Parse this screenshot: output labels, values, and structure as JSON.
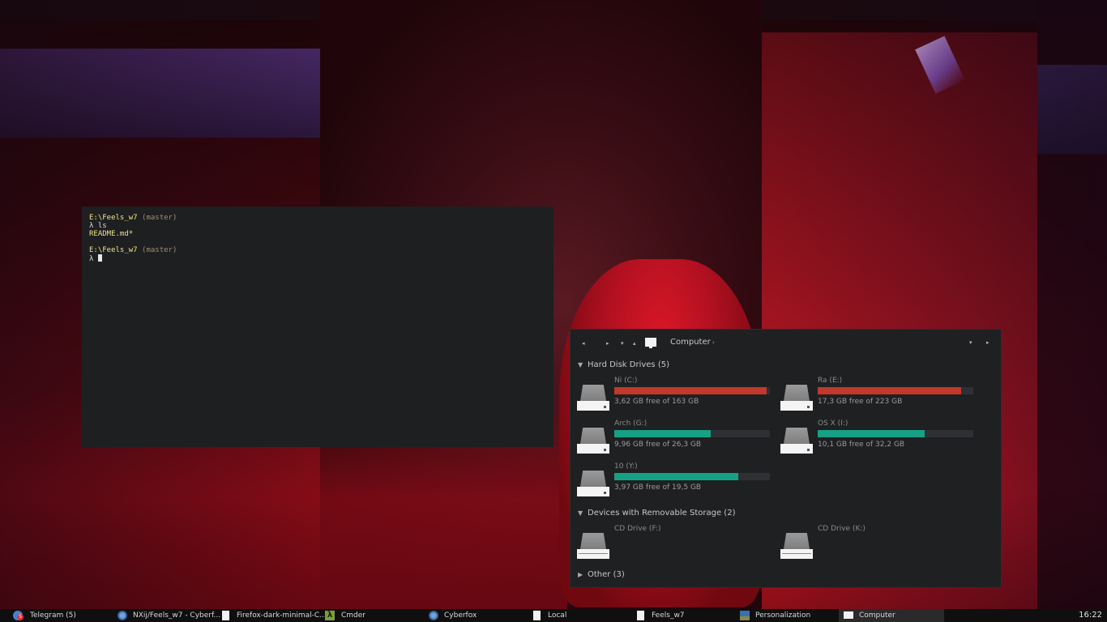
{
  "terminal": {
    "lines": [
      {
        "path": "E:\\Feels_w7",
        "branch": "(master)"
      },
      {
        "prompt": "λ ls"
      },
      {
        "file": "README.md*"
      },
      {
        "blank": ""
      },
      {
        "path": "E:\\Feels_w7",
        "branch": "(master)"
      },
      {
        "prompt": "λ "
      }
    ]
  },
  "explorer": {
    "address": {
      "back_icon": "◂",
      "forward_icon": "▸",
      "recent_icon": "▾",
      "up_icon": "▴",
      "location": "Computer",
      "chevron": "›",
      "dropdown_icon": "▾",
      "refresh_icon": "▸"
    },
    "groups": {
      "hard_disks": {
        "label": "Hard Disk Drives (5)",
        "expanded_icon": "▼"
      },
      "removable": {
        "label": "Devices with Removable Storage (2)",
        "expanded_icon": "▼"
      },
      "other": {
        "label": "Other (3)",
        "collapsed_icon": "▶"
      }
    },
    "drives": [
      {
        "name": "Ni (C:)",
        "free": "3,62 GB free of 163 GB",
        "used_fraction": 0.978,
        "color": "#c0392b"
      },
      {
        "name": "Ra (E:)",
        "free": "17,3 GB free of 223 GB",
        "used_fraction": 0.922,
        "color": "#c0392b"
      },
      {
        "name": "Arch (G:)",
        "free": "9,96 GB free of 26,3 GB",
        "used_fraction": 0.621,
        "color": "#16a085"
      },
      {
        "name": "OS X (I:)",
        "free": "10,1 GB free of 32,2 GB",
        "used_fraction": 0.686,
        "color": "#16a085"
      },
      {
        "name": "10 (Y:)",
        "free": "3,97 GB free of 19,5 GB",
        "used_fraction": 0.796,
        "color": "#16a085"
      }
    ],
    "removable_drives": [
      {
        "name": "CD Drive (F:)"
      },
      {
        "name": "CD Drive (K:)"
      }
    ]
  },
  "taskbar": {
    "items": [
      {
        "label": "Telegram (5)",
        "icon": "telegram-icon"
      },
      {
        "label": "NXij/Feels_w7 - Cyberf...",
        "icon": "cyberfox-icon"
      },
      {
        "label": "Firefox-dark-minimal-C...",
        "icon": "document-icon"
      },
      {
        "label": "Cmder",
        "icon": "cmder-icon"
      },
      {
        "label": "Cyberfox",
        "icon": "cyberfox-icon"
      },
      {
        "label": "Local",
        "icon": "document-icon"
      },
      {
        "label": "Feels_w7",
        "icon": "document-icon"
      },
      {
        "label": "Personalization",
        "icon": "personalization-icon"
      },
      {
        "label": "Computer",
        "icon": "computer-icon"
      }
    ],
    "clock": "16:22"
  }
}
